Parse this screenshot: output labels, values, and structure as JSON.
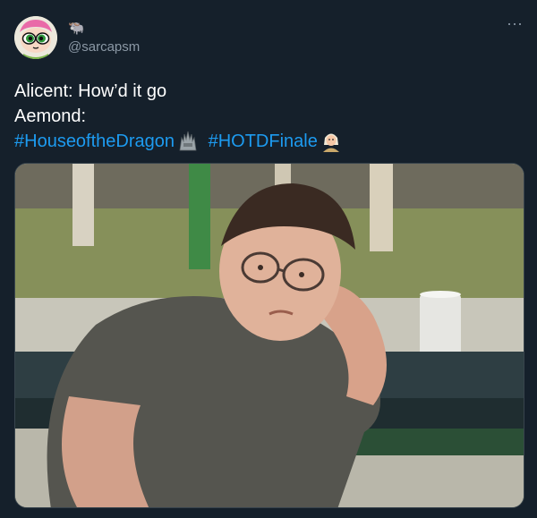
{
  "author": {
    "display_name_glyph": "🐃",
    "handle": "@sarcapsm",
    "avatar_icon": "powerpuff-girl-avatar-icon"
  },
  "menu": {
    "more_label": "···"
  },
  "tweet": {
    "line1": "Alicent: How’d it go",
    "line2": "Aemond:",
    "hashtags": [
      "#HouseoftheDragon",
      "#HOTDFinale"
    ],
    "hashtag_emojis": [
      "iron-throne-icon",
      "dragon-character-icon"
    ]
  },
  "colors": {
    "background": "#15202b",
    "text": "#ffffff",
    "secondary_text": "#8b98a5",
    "link": "#1d9bf0",
    "border": "#38444d"
  }
}
